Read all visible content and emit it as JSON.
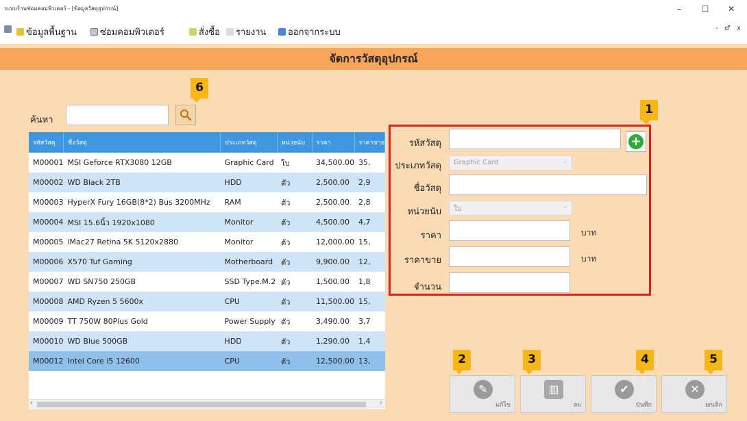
{
  "window": {
    "title": "ระบบร้านซ่อมคอมพิวเตอร์ - [ข้อมูลวัสดุอุปกรณ์]",
    "controls": [
      "–",
      "☐",
      "✕"
    ]
  },
  "menubar": {
    "items": [
      {
        "label": "ข้อมูลพื้นฐาน",
        "icon": "database-icon"
      },
      {
        "label": "ซ่อมคอมพิวเตอร์",
        "icon": "computer-icon"
      },
      {
        "label": "สั่งซื้อ",
        "icon": "cart-icon"
      },
      {
        "label": "รายงาน",
        "icon": "report-icon"
      },
      {
        "label": "ออกจากระบบ",
        "icon": "logout-icon"
      }
    ],
    "mdi_controls": "- ♂ x"
  },
  "page": {
    "title": "จัดการวัสดุอุปกรณ์"
  },
  "search": {
    "label": "ค้นหา",
    "value": "",
    "badge": "6"
  },
  "grid": {
    "columns": [
      "รหัสวัสดุ",
      "ชื่อวัสดุ",
      "ประเภทวัสดุ",
      "หน่วยนับ",
      "ราคา",
      "ราคาขาย"
    ],
    "rows": [
      [
        "M00001",
        "MSI Geforce RTX3080 12GB",
        "Graphic Card",
        "ใบ",
        "34,500.00",
        "35,"
      ],
      [
        "M00002",
        "WD Black 2TB",
        "HDD",
        "ตัว",
        "2,500.00",
        "2,9"
      ],
      [
        "M00003",
        "HyperX Fury 16GB(8*2) Bus 3200MHz",
        "RAM",
        "ตัว",
        "2,500.00",
        "2,8"
      ],
      [
        "M00004",
        "MSI 15.6นิ้ว 1920x1080",
        "Monitor",
        "ตัว",
        "4,500.00",
        "4,7"
      ],
      [
        "M00005",
        "iMac27 Retina 5K 5120x2880",
        "Monitor",
        "ตัว",
        "12,000.00",
        "15,"
      ],
      [
        "M00006",
        "X570 Tuf Gaming",
        "Motherboard",
        "ตัว",
        "9,900.00",
        "12,"
      ],
      [
        "M00007",
        "WD SN750 250GB",
        "SSD Type.M.2",
        "ตัว",
        "1,500.00",
        "1,8"
      ],
      [
        "M00008",
        "AMD Ryzen 5 5600x",
        "CPU",
        "ตัว",
        "11,500.00",
        "15,"
      ],
      [
        "M00009",
        "TT 750W 80Plus Gold",
        "Power Supply",
        "ตัว",
        "3,490.00",
        "3,7"
      ],
      [
        "M00010",
        "WD Blue 500GB",
        "HDD",
        "ตัว",
        "1,290.00",
        "1,4"
      ],
      [
        "M00012",
        "Intel Core i5 12600",
        "CPU",
        "ตัว",
        "12,500.00",
        "13,"
      ]
    ],
    "selected_row_index": 10
  },
  "form": {
    "badge": "1",
    "code_label": "รหัสวัสดุ",
    "code_value": "",
    "type_label": "ประเภทวัสดุ",
    "type_value": "Graphic Card",
    "name_label": "ชื่อวัสดุ",
    "name_value": "",
    "unit_label": "หน่วยนับ",
    "unit_value": "ใบ",
    "price_label": "ราคา",
    "price_value": "",
    "price_unit": "บาท",
    "sell_label": "ราคาขาย",
    "sell_value": "",
    "sell_unit": "บาท",
    "qty_label": "จำนวน",
    "qty_value": ""
  },
  "actions": [
    {
      "badge": "2",
      "label": "แก้ไข",
      "icon": "edit-icon",
      "glyph": "✎"
    },
    {
      "badge": "3",
      "label": "ลบ",
      "icon": "trash-icon",
      "glyph": "▥"
    },
    {
      "badge": "4",
      "label": "บันทึก",
      "icon": "check-icon",
      "glyph": "✔"
    },
    {
      "badge": "5",
      "label": "ยกเลิก",
      "icon": "cancel-icon",
      "glyph": "✕"
    }
  ],
  "colors": {
    "header": "#f6a55b",
    "background": "#fadbb3",
    "grid_header": "#3e97e0",
    "highlight_frame": "#e3231b",
    "badge": "#f5b717",
    "add_button": "#2eaa3a"
  }
}
